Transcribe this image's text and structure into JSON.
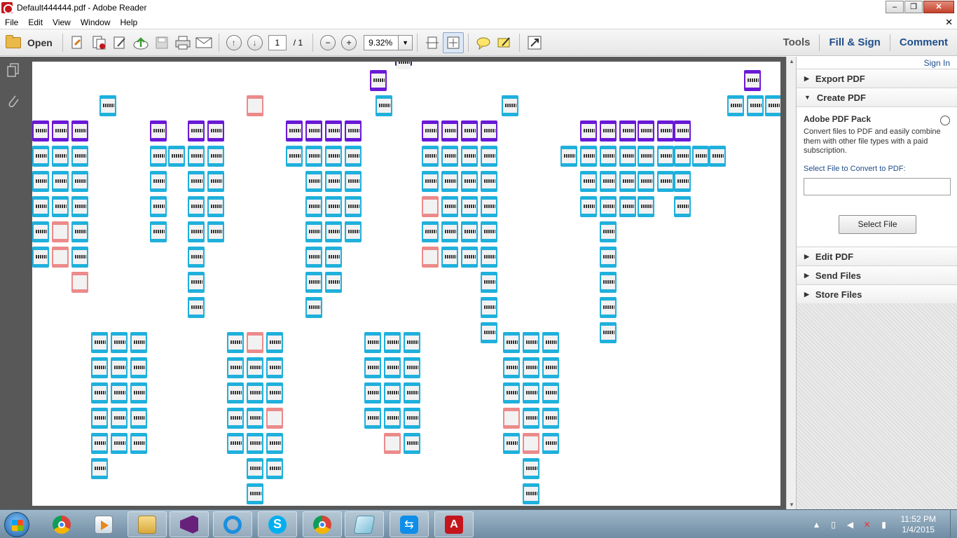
{
  "window": {
    "title": "Default444444.pdf - Adobe Reader",
    "minimize_label": "–",
    "restore_label": "❐",
    "close_label": "✕"
  },
  "menu": {
    "items": [
      "File",
      "Edit",
      "View",
      "Window",
      "Help"
    ],
    "close_label": "✕"
  },
  "toolbar": {
    "open_label": "Open",
    "page_current": "1",
    "page_total": "/ 1",
    "zoom": "9.32%",
    "tabs": [
      "Tools",
      "Fill & Sign",
      "Comment"
    ]
  },
  "right_panel": {
    "sign_in": "Sign In",
    "sections_top": [
      {
        "label": "Export PDF",
        "expanded": false
      },
      {
        "label": "Create PDF",
        "expanded": true
      }
    ],
    "create_pdf": {
      "title": "Adobe PDF Pack",
      "description": "Convert files to PDF and easily combine them with other file types with a paid subscription.",
      "select_label": "Select File to Convert to PDF:",
      "select_button": "Select File"
    },
    "sections_bottom": [
      {
        "label": "Edit PDF"
      },
      {
        "label": "Send Files"
      },
      {
        "label": "Store Files"
      }
    ]
  },
  "taskbar": {
    "time": "11:52 PM",
    "date": "1/4/2015",
    "apps": [
      "chrome-icon",
      "media-player-icon",
      "file-explorer-icon",
      "visual-studio-icon",
      "internet-explorer-icon",
      "skype-icon",
      "chrome-icon",
      "notepad-icon",
      "teamviewer-icon",
      "adobe-reader-icon"
    ]
  },
  "colors": {
    "card_blue": "#1fb0dc",
    "card_purple": "#6a19d6",
    "card_pink": "#ec8a8a",
    "card_navy": "#1a2a7a",
    "link_blue": "#1f4e8a"
  }
}
